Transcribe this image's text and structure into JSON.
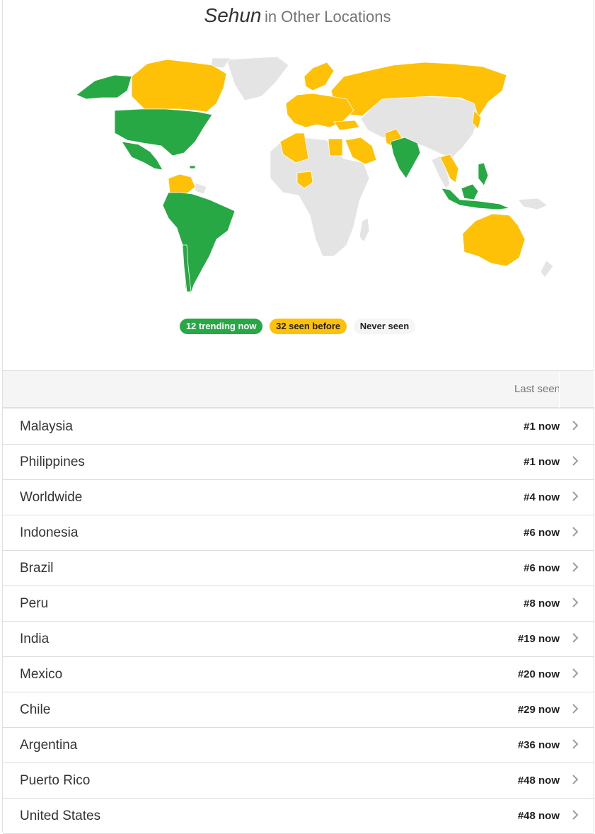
{
  "header": {
    "name": "Sehun",
    "subtitle": "in Other Locations"
  },
  "legend": {
    "trending": "12 trending now",
    "seen_before": "32 seen before",
    "never_seen": "Never seen"
  },
  "colors": {
    "trending": "#28a745",
    "seen_before": "#ffc107",
    "never_seen": "#e4e4e4"
  },
  "table": {
    "header_last_seen": "Last seen",
    "rows": [
      {
        "location": "Malaysia",
        "rank": "#1 now"
      },
      {
        "location": "Philippines",
        "rank": "#1 now"
      },
      {
        "location": "Worldwide",
        "rank": "#4 now"
      },
      {
        "location": "Indonesia",
        "rank": "#6 now"
      },
      {
        "location": "Brazil",
        "rank": "#6 now"
      },
      {
        "location": "Peru",
        "rank": "#8 now"
      },
      {
        "location": "India",
        "rank": "#19 now"
      },
      {
        "location": "Mexico",
        "rank": "#20 now"
      },
      {
        "location": "Chile",
        "rank": "#29 now"
      },
      {
        "location": "Argentina",
        "rank": "#36 now"
      },
      {
        "location": "Puerto Rico",
        "rank": "#48 now"
      },
      {
        "location": "United States",
        "rank": "#48 now"
      }
    ]
  },
  "icons": {
    "row_chevron": "chevron-right-icon"
  }
}
